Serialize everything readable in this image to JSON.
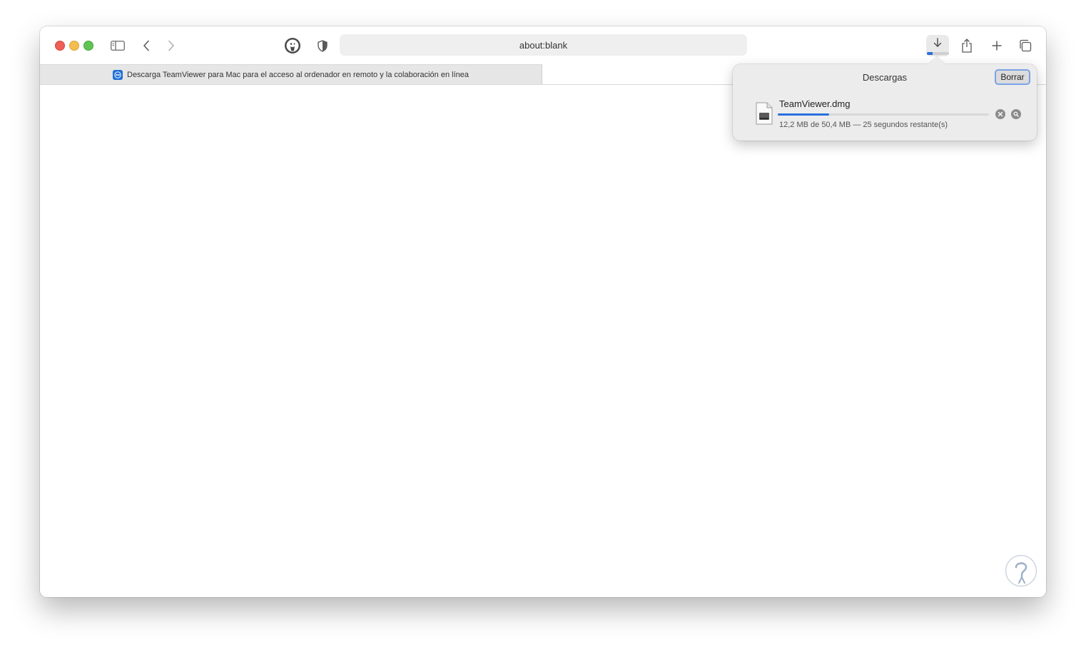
{
  "browser": {
    "address": "about:blank",
    "tab_title": "Descarga TeamViewer para Mac para el acceso al ordenador en remoto y la colaboración en línea"
  },
  "downloads": {
    "title": "Descargas",
    "clear_label": "Borrar",
    "item": {
      "file_name": "TeamViewer.dmg",
      "status": "12,2 MB de 50,4 MB — 25 segundos restante(s)",
      "progress": 0.242
    }
  },
  "colors": {
    "accent": "#2a6fdb",
    "close": "#ed5f57",
    "minimize": "#f4bd4f",
    "zoom": "#5fc454"
  },
  "icons": [
    "sidebar-icon",
    "back-icon",
    "forward-icon",
    "duckduckgo-icon",
    "privacy-shield-icon",
    "download-icon",
    "share-icon",
    "new-tab-icon",
    "tab-overview-icon",
    "teamviewer-favicon",
    "disk-image-icon",
    "cancel-icon",
    "reveal-icon"
  ]
}
